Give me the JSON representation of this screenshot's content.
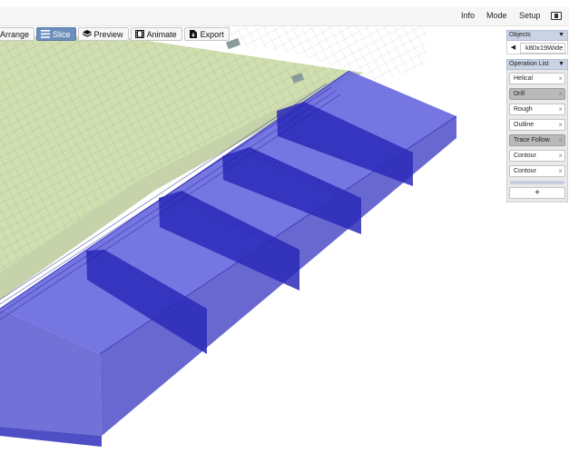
{
  "menu": {
    "info": "Info",
    "mode": "Mode",
    "setup": "Setup",
    "display_icon": "display-icon"
  },
  "toolbar": [
    {
      "label": "Arrange",
      "icon": "arrange-icon",
      "active": false
    },
    {
      "label": "Slice",
      "icon": "list-icon",
      "active": true
    },
    {
      "label": "Preview",
      "icon": "layers-icon",
      "active": false
    },
    {
      "label": "Animate",
      "icon": "film-icon",
      "active": false
    },
    {
      "label": "Export",
      "icon": "export-icon",
      "active": false
    }
  ],
  "objects": {
    "header": "Objects",
    "selected": "k80x19Wide"
  },
  "operations": {
    "header": "Operation List",
    "items": [
      {
        "label": "Helical",
        "selected": false
      },
      {
        "label": "Drill",
        "selected": true
      },
      {
        "label": "Rough",
        "selected": false
      },
      {
        "label": "Outline",
        "selected": false
      },
      {
        "label": "Trace Follow",
        "selected": true
      },
      {
        "label": "Contour",
        "selected": false
      },
      {
        "label": "Contour",
        "selected": false
      }
    ],
    "add_label": "+",
    "remove_glyph": "×"
  },
  "colors": {
    "stock": "#6a6adf",
    "stock_edge": "#3b3bbf",
    "slot": "#2a2ab8",
    "bed": "#c9d9a0",
    "grid": "#9aa8a8",
    "active_button": "#6d8fbd"
  }
}
